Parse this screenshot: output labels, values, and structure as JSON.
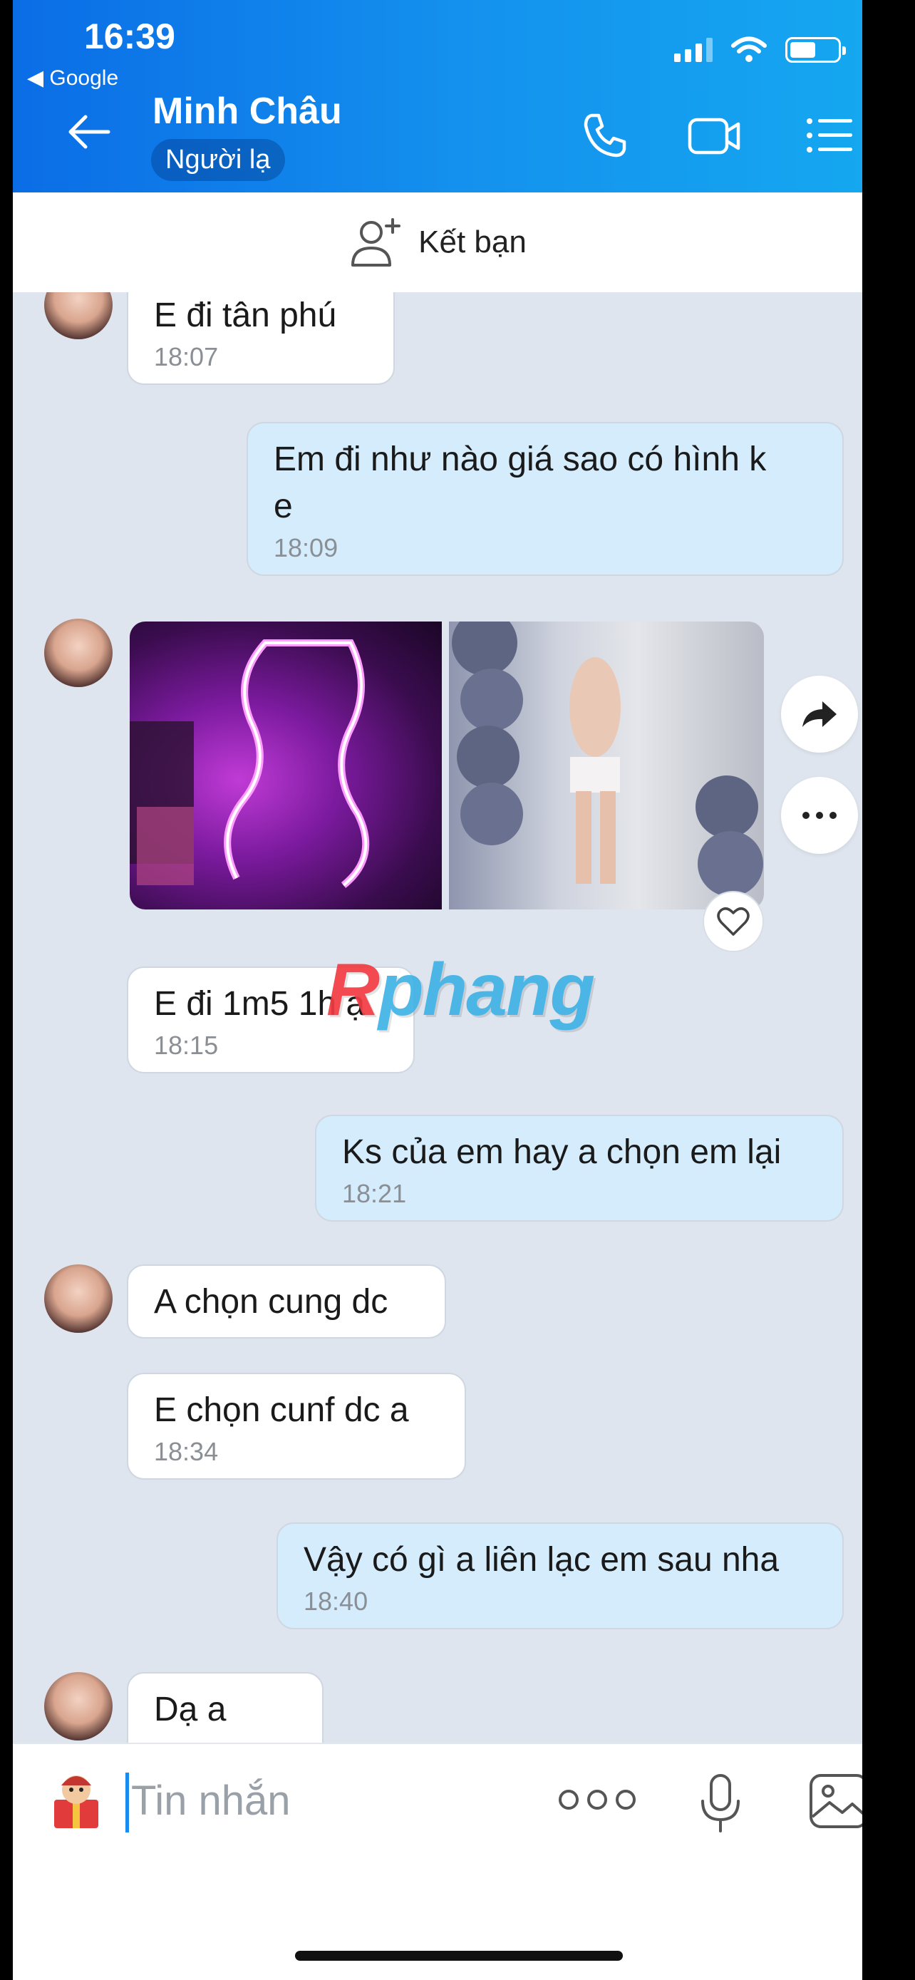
{
  "status_bar": {
    "time": "16:39",
    "back_app": "◀ Google"
  },
  "header": {
    "name": "Minh Châu",
    "tag": "Người lạ"
  },
  "add_friend": {
    "label": "Kết bạn"
  },
  "messages": {
    "m1": {
      "text": "E đi tân phú",
      "time": "18:07"
    },
    "m2": {
      "text": "Em đi như nào giá sao có hình k\ne",
      "time": "18:09"
    },
    "m3": {
      "text": "E đi 1m5 1h ạ",
      "time": "18:15"
    },
    "m4": {
      "text": "Ks của em hay a chọn em lại",
      "time": "18:21"
    },
    "m5": {
      "text": "A chọn cung dc"
    },
    "m6": {
      "text": "E chọn cunf dc a",
      "time": "18:34"
    },
    "m7": {
      "text": "Vậy có gì a liên lạc em sau nha",
      "time": "18:40"
    },
    "m8": {
      "text": "Dạ a"
    }
  },
  "watermark": {
    "r": "R",
    "rest": "phang"
  },
  "input": {
    "placeholder": "Tin nhắn"
  },
  "colors": {
    "header_start": "#0b6de6",
    "header_end": "#15a7f0",
    "outgoing_bubble": "#d4ecfb",
    "incoming_bubble": "#ffffff",
    "chat_bg": "#dfe5ee"
  },
  "icons": [
    "back-arrow-icon",
    "phone-icon",
    "video-call-icon",
    "menu-icon",
    "add-friend-icon",
    "forward-icon",
    "more-icon",
    "heart-icon",
    "sticker-icon",
    "mic-icon",
    "gallery-icon"
  ]
}
